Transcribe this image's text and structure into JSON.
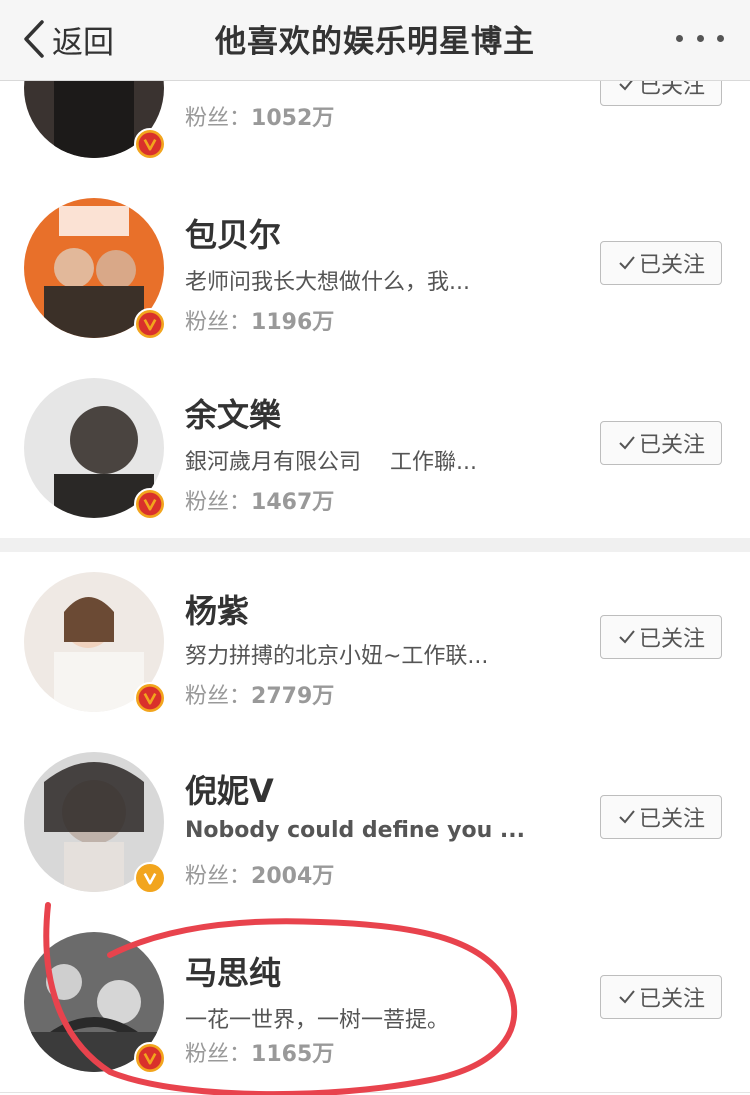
{
  "header": {
    "back_label": "返回",
    "title": "他喜欢的娱乐明星博主"
  },
  "follow_label": "已关注",
  "fans_prefix": "粉丝：",
  "users": [
    {
      "name": "",
      "bio": "",
      "fans": "1052万"
    },
    {
      "name": "包贝尔",
      "bio": "老师问我长大想做什么，我...",
      "fans": "1196万"
    },
    {
      "name": "余文樂",
      "bio": "銀河歲月有限公司　 工作聯...",
      "fans": "1467万"
    },
    {
      "name": "杨紫",
      "bio": "努力拼搏的北京小妞~工作联...",
      "fans": "2779万"
    },
    {
      "name": "倪妮V",
      "bio": "Nobody could define you ...",
      "fans": "2004万"
    },
    {
      "name": "马思纯",
      "bio": "一花一世界，一树一菩提。",
      "fans": "1165万"
    }
  ],
  "colors": {
    "verified_badge": "#f2a51d",
    "annotation": "#e8434d"
  }
}
